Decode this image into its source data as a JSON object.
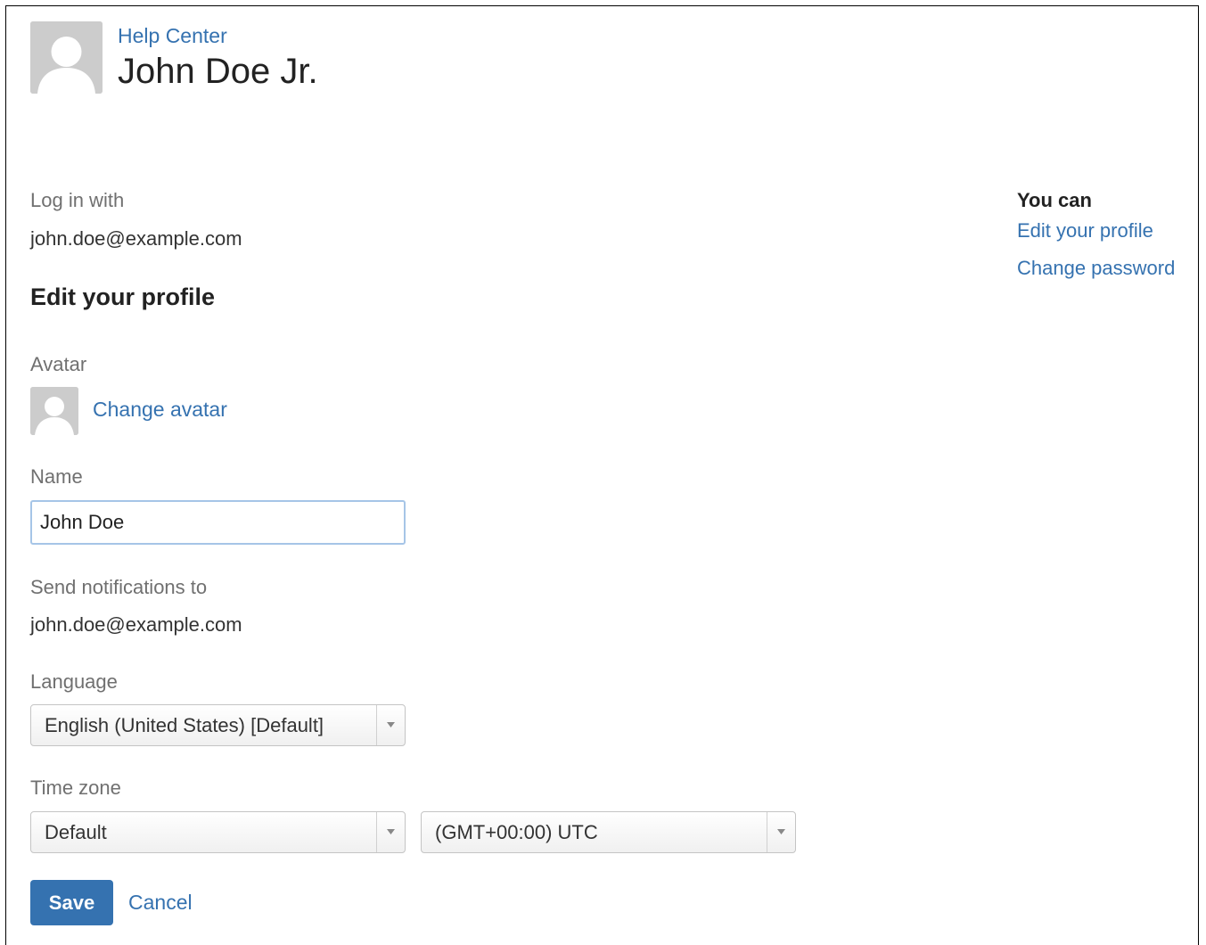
{
  "header": {
    "breadcrumb": "Help Center",
    "user_name": "John Doe Jr."
  },
  "login": {
    "label": "Log in with",
    "email": "john.doe@example.com"
  },
  "form": {
    "heading": "Edit your profile",
    "avatar_label": "Avatar",
    "change_avatar_link": "Change avatar",
    "name_label": "Name",
    "name_value": "John Doe",
    "notifications_label": "Send notifications to",
    "notifications_email": "john.doe@example.com",
    "language_label": "Language",
    "language_selected": "English (United States) [Default]",
    "timezone_label": "Time zone",
    "timezone_mode_selected": "Default",
    "timezone_selected": "(GMT+00:00) UTC",
    "save_label": "Save",
    "cancel_label": "Cancel"
  },
  "sidebar": {
    "heading": "You can",
    "links": [
      {
        "label": "Edit your profile"
      },
      {
        "label": "Change password"
      }
    ]
  },
  "colors": {
    "link": "#3572b0",
    "primary_button": "#3572b0",
    "avatar_bg": "#cccccc"
  }
}
